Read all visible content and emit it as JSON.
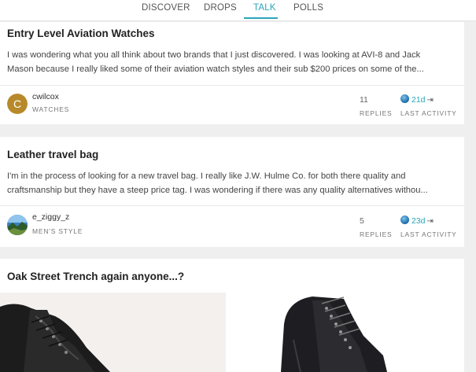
{
  "nav": {
    "tabs": [
      {
        "label": "DISCOVER",
        "active": false
      },
      {
        "label": "DROPS",
        "active": false
      },
      {
        "label": "TALK",
        "active": true
      },
      {
        "label": "POLLS",
        "active": false
      }
    ],
    "accent_color": "#2aa6b8"
  },
  "posts": [
    {
      "title": "Entry Level Aviation Watches",
      "excerpt_line1": "I was wondering what you all think about two brands that I just discovered. I was looking at AVI-8 and Jack",
      "excerpt_line2": "Mason because I really liked some of their aviation watch styles and their sub $200 prices on some of the...",
      "avatar_letter": "C",
      "username": "cwilcox",
      "category": "WATCHES",
      "replies": "11",
      "replies_label": "REPLIES",
      "last_activity": "21d",
      "last_activity_label": "LAST ACTIVITY"
    },
    {
      "title": "Leather travel bag",
      "excerpt_line1": "I'm in the process of looking for a new travel bag. I really like J.W. Hulme Co. for both there quality and",
      "excerpt_line2": "craftsmanship but they have a steep price tag. I was wondering if there was any quality alternatives withou...",
      "avatar_letter": "",
      "username": "e_ziggy_z",
      "category": "MEN'S STYLE",
      "replies": "5",
      "replies_label": "REPLIES",
      "last_activity": "23d",
      "last_activity_label": "LAST ACTIVITY"
    },
    {
      "title": "Oak Street Trench again anyone...?"
    }
  ],
  "icons": {
    "activity": "globe-icon",
    "jump": "jump-to-end-icon"
  }
}
